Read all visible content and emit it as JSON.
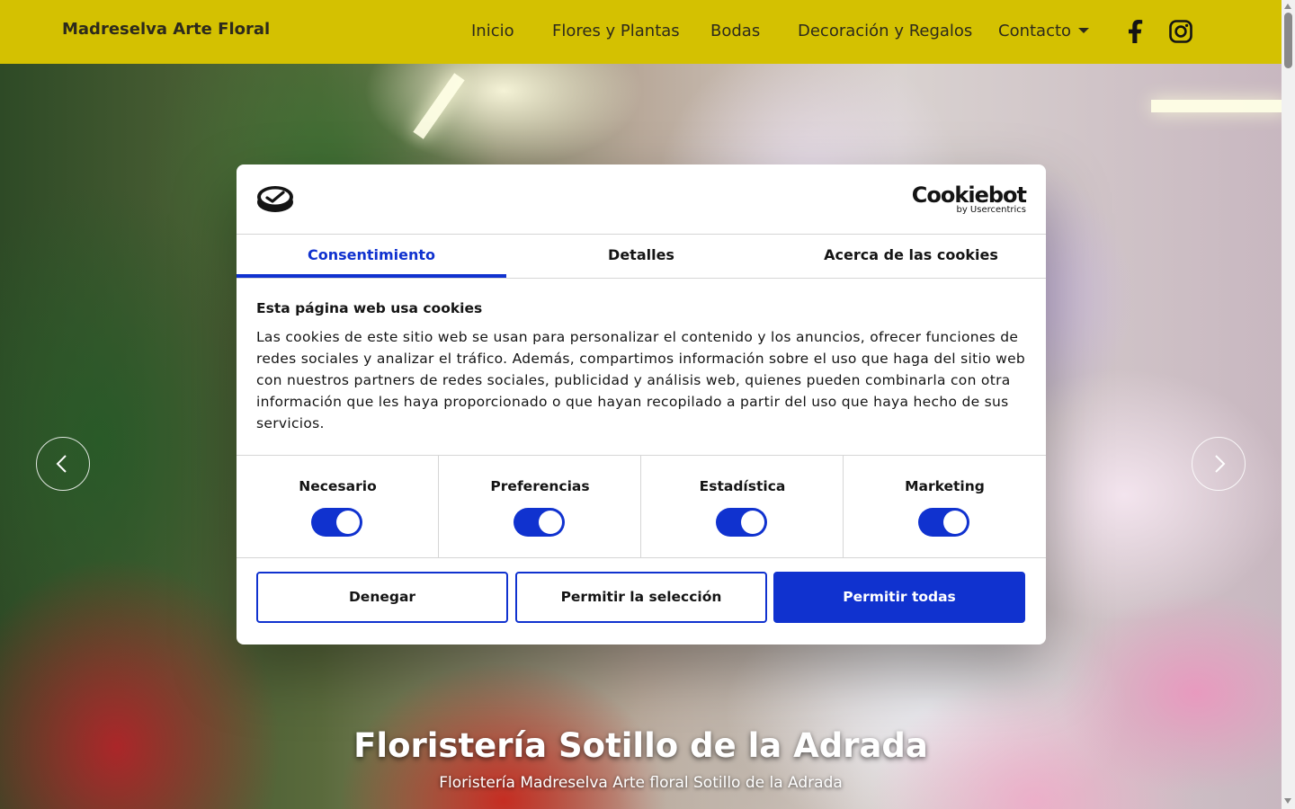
{
  "header": {
    "brand": "Madreselva Arte Floral",
    "nav": [
      {
        "label": "Inicio"
      },
      {
        "label": "Flores y Plantas"
      },
      {
        "label": "Bodas"
      },
      {
        "label": "Decoración y Regalos"
      },
      {
        "label": "Contacto",
        "icon": "caret-down-icon"
      }
    ],
    "social": [
      "facebook-icon",
      "instagram-icon"
    ],
    "background_color": "#d4c101"
  },
  "hero": {
    "title": "Floristería Sotillo de la Adrada",
    "subtitle": "Floristería Madreselva Arte floral Sotillo de la Adrada",
    "prev_icon": "chevron-left-icon",
    "next_icon": "chevron-right-icon"
  },
  "cookie_dialog": {
    "logo_icon": "cookie-logo-icon",
    "provider": {
      "name": "Cookiebot",
      "by": "by Usercentrics"
    },
    "tabs": [
      {
        "label": "Consentimiento",
        "active": true
      },
      {
        "label": "Detalles",
        "active": false
      },
      {
        "label": "Acerca de las cookies",
        "active": false
      }
    ],
    "heading": "Esta página web usa cookies",
    "body": "Las cookies de este sitio web se usan para personalizar el contenido y los anuncios, ofrecer funciones de redes sociales y analizar el tráfico. Además, compartimos información sobre el uso que haga del sitio web con nuestros partners de redes sociales, publicidad y análisis web, quienes pueden combinarla con otra información que les haya proporcionado o que hayan recopilado a partir del uso que haya hecho de sus servicios.",
    "categories": [
      {
        "label": "Necesario",
        "enabled": true
      },
      {
        "label": "Preferencias",
        "enabled": true
      },
      {
        "label": "Estadística",
        "enabled": true
      },
      {
        "label": "Marketing",
        "enabled": true
      }
    ],
    "buttons": {
      "deny": "Denegar",
      "allow_selection": "Permitir la selección",
      "allow_all": "Permitir todas"
    },
    "accent_color": "#1032cf"
  }
}
